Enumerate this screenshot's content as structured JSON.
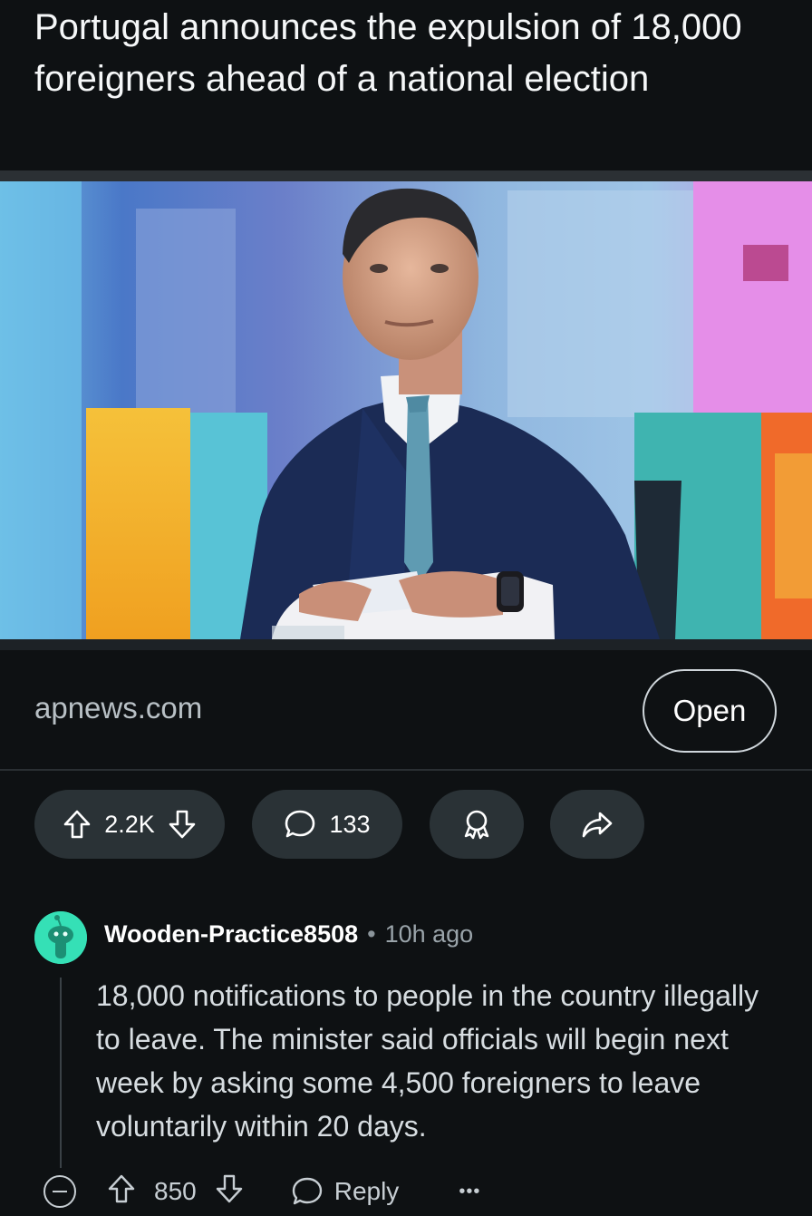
{
  "post": {
    "title": "Portugal announces the expulsion of 18,000 foreigners ahead of a national election",
    "link_domain": "apnews.com",
    "open_label": "Open",
    "vote_count": "2.2K",
    "comment_count": "133"
  },
  "comment": {
    "author": "Wooden-Practice8508",
    "separator": "•",
    "time": "10h ago",
    "body": "18,000 notifications to people in the country illegally to leave. The minister said officials will begin next week by asking some 4,500 foreigners to leave voluntarily within 20 days.",
    "vote_count": "850",
    "reply_label": "Reply",
    "more_label": "•••"
  },
  "icons": {
    "upvote": "arrow-up-icon",
    "downvote": "arrow-down-icon",
    "comments": "speech-bubble-icon",
    "award": "award-icon",
    "share": "share-arrow-icon",
    "collapse": "collapse-minus-icon"
  },
  "colors": {
    "background": "#0e1113",
    "pill": "#2a3236",
    "avatar": "#35e0b6"
  }
}
